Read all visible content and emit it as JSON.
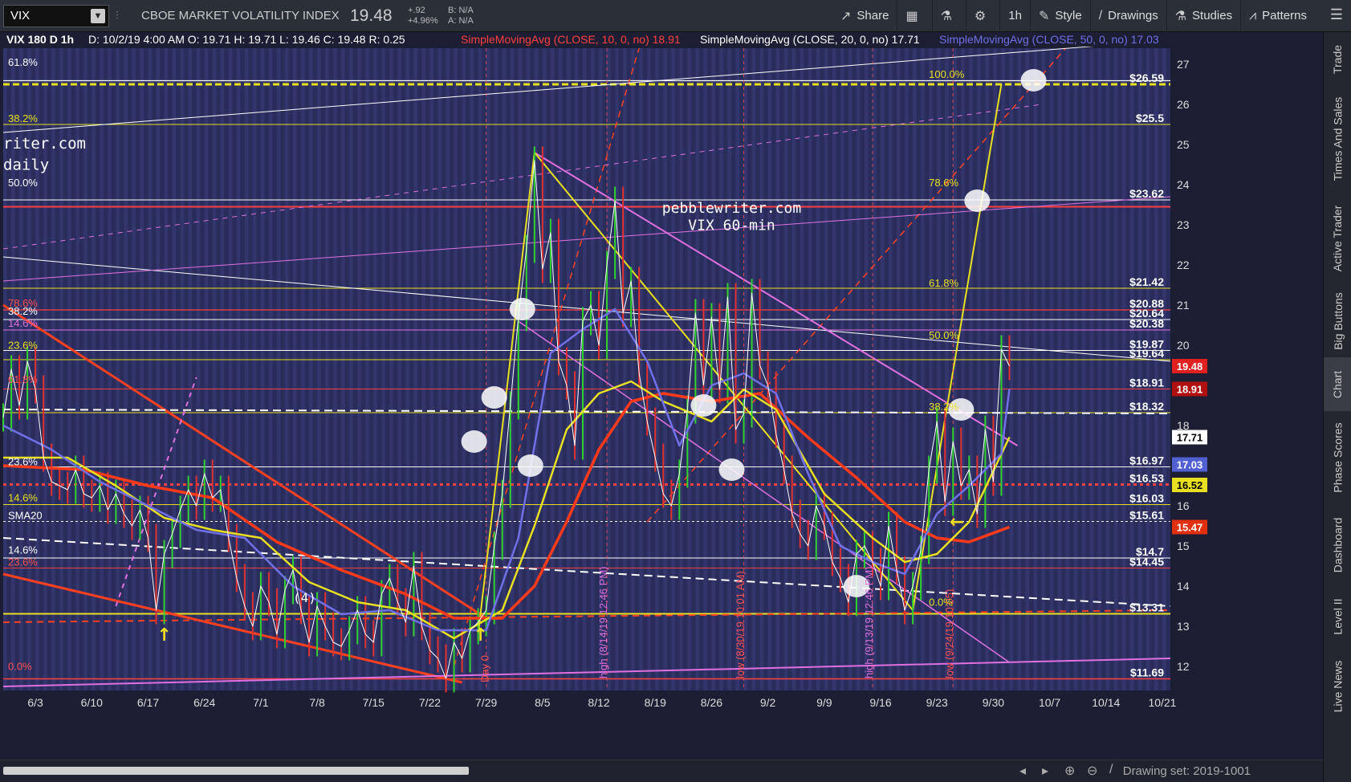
{
  "toolbar": {
    "symbol": "VIX",
    "description": "CBOE MARKET VOLATILITY INDEX",
    "last": "19.48",
    "change": "+.92",
    "change_pct": "+4.96%",
    "bid": "B: N/A",
    "ask": "A: N/A",
    "buttons": [
      {
        "label": "Share",
        "icon": "share-icon"
      },
      {
        "label": "",
        "icon": "grid-icon"
      },
      {
        "label": "",
        "icon": "flask-icon"
      },
      {
        "label": "",
        "icon": "gear-icon"
      },
      {
        "label": "1h",
        "icon": ""
      },
      {
        "label": "Style",
        "icon": "style-icon"
      },
      {
        "label": "Drawings",
        "icon": "pencil-icon"
      },
      {
        "label": "Studies",
        "icon": "flask-icon"
      },
      {
        "label": "Patterns",
        "icon": "patterns-icon"
      }
    ]
  },
  "sidebar": {
    "tabs": [
      "Trade",
      "Times And Sales",
      "Active Trader",
      "Big Buttons",
      "Chart",
      "Phase Scores",
      "Dashboard",
      "Level II",
      "Live News"
    ],
    "active": "Chart"
  },
  "header_info": {
    "title": "VIX 180 D 1h",
    "ohlc": "D: 10/2/19 4:00 AM  O: 19.71  H: 19.71  L: 19.46  C: 19.48  R: 0.25",
    "sma10": "SimpleMovingAvg (CLOSE, 10, 0, no)  18.91",
    "sma20": "SimpleMovingAvg (CLOSE, 20, 0, no)  17.71",
    "sma50": "SimpleMovingAvg (CLOSE, 50, 0, no)  17.03"
  },
  "status": {
    "drawing_set": "Drawing set: 2019-1001"
  },
  "watermark": {
    "line1": "pebblewriter.com",
    "line2": "VIX 60-min",
    "corner1": "riter.com",
    "corner2": "daily"
  },
  "annotations": [
    {
      "text": "(4)"
    },
    {
      "text": "high (8/14/19 12:46 PM)"
    },
    {
      "text": "low (8/30/19 10:01 AM)"
    },
    {
      "text": "high (9/13/19 12:46 PM)"
    },
    {
      "text": "low (9/24/19 10:05)"
    },
    {
      "text": "Day 0"
    }
  ],
  "chart_data": {
    "type": "line",
    "ylim": [
      11.4,
      27.4
    ],
    "y_ticks": [
      12,
      13,
      14,
      15,
      16,
      17,
      18,
      19,
      20,
      21,
      22,
      23,
      24,
      25,
      26,
      27
    ],
    "x_ticks": [
      "6/3",
      "6/10",
      "6/17",
      "6/24",
      "7/1",
      "7/8",
      "7/15",
      "7/22",
      "7/29",
      "8/5",
      "8/12",
      "8/19",
      "8/26",
      "9/2",
      "9/9",
      "9/16",
      "9/23",
      "9/30",
      "10/7",
      "10/14",
      "10/21"
    ],
    "x_tick_days": [
      0,
      7,
      14,
      21,
      28,
      35,
      42,
      49,
      56,
      63,
      70,
      77,
      84,
      91,
      98,
      105,
      112,
      119,
      126,
      133,
      140
    ],
    "x_range_days": [
      -4,
      141
    ],
    "price_series": [
      [
        -4,
        18.2
      ],
      [
        -3,
        19.4
      ],
      [
        -2,
        18.5
      ],
      [
        -1,
        19.6
      ],
      [
        0,
        18.9
      ],
      [
        1,
        17.2
      ],
      [
        2,
        16.6
      ],
      [
        3,
        16.5
      ],
      [
        4,
        16.4
      ],
      [
        5,
        16.9
      ],
      [
        6,
        16.3
      ],
      [
        7,
        16.2
      ],
      [
        8,
        16.5
      ],
      [
        9,
        15.9
      ],
      [
        10,
        16.3
      ],
      [
        11,
        15.8
      ],
      [
        12,
        15.5
      ],
      [
        13,
        15.9
      ],
      [
        14,
        15.2
      ],
      [
        15,
        13.4
      ],
      [
        16,
        14.8
      ],
      [
        17,
        15.3
      ],
      [
        18,
        15.9
      ],
      [
        19,
        16.4
      ],
      [
        20,
        16.0
      ],
      [
        21,
        16.8
      ],
      [
        22,
        16.2
      ],
      [
        23,
        16.4
      ],
      [
        24,
        15.2
      ],
      [
        25,
        14.2
      ],
      [
        26,
        13.5
      ],
      [
        27,
        13.0
      ],
      [
        28,
        14.0
      ],
      [
        29,
        13.6
      ],
      [
        30,
        12.8
      ],
      [
        31,
        13.9
      ],
      [
        32,
        14.4
      ],
      [
        33,
        13.4
      ],
      [
        34,
        12.6
      ],
      [
        35,
        13.5
      ],
      [
        36,
        13.0
      ],
      [
        37,
        12.6
      ],
      [
        38,
        12.5
      ],
      [
        39,
        12.9
      ],
      [
        40,
        13.4
      ],
      [
        41,
        12.8
      ],
      [
        42,
        12.6
      ],
      [
        43,
        13.8
      ],
      [
        44,
        14.2
      ],
      [
        45,
        13.6
      ],
      [
        46,
        13.1
      ],
      [
        47,
        14.5
      ],
      [
        48,
        13.0
      ],
      [
        49,
        12.4
      ],
      [
        50,
        12.2
      ],
      [
        51,
        11.7
      ],
      [
        52,
        12.6
      ],
      [
        53,
        12.2
      ],
      [
        54,
        12.9
      ],
      [
        55,
        13.1
      ],
      [
        56,
        13.4
      ],
      [
        57,
        15.0
      ],
      [
        58,
        16.3
      ],
      [
        59,
        18.5
      ],
      [
        60,
        20.7
      ],
      [
        61,
        22.4
      ],
      [
        62,
        24.6
      ],
      [
        63,
        21.9
      ],
      [
        64,
        22.8
      ],
      [
        65,
        19.6
      ],
      [
        66,
        19.0
      ],
      [
        67,
        17.5
      ],
      [
        68,
        20.6
      ],
      [
        69,
        21.0
      ],
      [
        70,
        20.0
      ],
      [
        71,
        22.0
      ],
      [
        72,
        23.6
      ],
      [
        73,
        20.8
      ],
      [
        74,
        21.6
      ],
      [
        75,
        19.3
      ],
      [
        76,
        18.1
      ],
      [
        77,
        17.2
      ],
      [
        78,
        16.3
      ],
      [
        79,
        16.0
      ],
      [
        80,
        16.8
      ],
      [
        81,
        18.4
      ],
      [
        82,
        20.8
      ],
      [
        83,
        19.0
      ],
      [
        84,
        20.7
      ],
      [
        85,
        18.9
      ],
      [
        86,
        21.2
      ],
      [
        87,
        17.9
      ],
      [
        88,
        18.3
      ],
      [
        89,
        21.3
      ],
      [
        90,
        19.5
      ],
      [
        91,
        19.0
      ],
      [
        92,
        17.8
      ],
      [
        93,
        16.9
      ],
      [
        94,
        15.8
      ],
      [
        95,
        15.3
      ],
      [
        96,
        15.0
      ],
      [
        97,
        16.0
      ],
      [
        98,
        15.5
      ],
      [
        99,
        14.6
      ],
      [
        100,
        14.2
      ],
      [
        101,
        13.6
      ],
      [
        102,
        14.8
      ],
      [
        103,
        15.0
      ],
      [
        104,
        14.6
      ],
      [
        105,
        14.0
      ],
      [
        106,
        15.5
      ],
      [
        107,
        14.4
      ],
      [
        108,
        13.4
      ],
      [
        109,
        14.0
      ],
      [
        110,
        14.9
      ],
      [
        111,
        16.9
      ],
      [
        112,
        18.1
      ],
      [
        113,
        16.1
      ],
      [
        114,
        17.6
      ],
      [
        115,
        16.5
      ],
      [
        116,
        16.9
      ],
      [
        117,
        15.8
      ],
      [
        118,
        17.9
      ],
      [
        119,
        16.6
      ],
      [
        120,
        19.9
      ],
      [
        121,
        19.48
      ]
    ],
    "sma10_series": [
      [
        -4,
        18.0
      ],
      [
        2,
        17.4
      ],
      [
        8,
        16.6
      ],
      [
        14,
        16.0
      ],
      [
        20,
        15.4
      ],
      [
        26,
        15.2
      ],
      [
        32,
        14.0
      ],
      [
        38,
        13.3
      ],
      [
        44,
        13.4
      ],
      [
        50,
        12.9
      ],
      [
        56,
        12.9
      ],
      [
        60,
        15.2
      ],
      [
        64,
        19.8
      ],
      [
        68,
        20.4
      ],
      [
        72,
        20.9
      ],
      [
        76,
        19.6
      ],
      [
        80,
        17.5
      ],
      [
        84,
        19.0
      ],
      [
        88,
        19.3
      ],
      [
        92,
        18.8
      ],
      [
        96,
        16.8
      ],
      [
        100,
        15.0
      ],
      [
        104,
        14.6
      ],
      [
        108,
        14.3
      ],
      [
        112,
        15.8
      ],
      [
        116,
        16.5
      ],
      [
        120,
        17.3
      ],
      [
        121,
        18.91
      ]
    ],
    "sma20_series": [
      [
        -4,
        17.2
      ],
      [
        4,
        17.2
      ],
      [
        10,
        16.5
      ],
      [
        16,
        15.7
      ],
      [
        22,
        15.4
      ],
      [
        28,
        15.2
      ],
      [
        34,
        14.1
      ],
      [
        40,
        13.6
      ],
      [
        46,
        13.4
      ],
      [
        52,
        12.7
      ],
      [
        58,
        13.4
      ],
      [
        62,
        15.5
      ],
      [
        66,
        17.9
      ],
      [
        70,
        18.8
      ],
      [
        74,
        19.1
      ],
      [
        78,
        18.6
      ],
      [
        84,
        18.1
      ],
      [
        88,
        18.9
      ],
      [
        92,
        18.4
      ],
      [
        98,
        16.3
      ],
      [
        104,
        15.2
      ],
      [
        108,
        14.6
      ],
      [
        112,
        14.8
      ],
      [
        116,
        15.6
      ],
      [
        121,
        17.71
      ]
    ],
    "sma50_series": [
      [
        -4,
        17.0
      ],
      [
        6,
        16.9
      ],
      [
        14,
        16.5
      ],
      [
        22,
        16.2
      ],
      [
        30,
        15.1
      ],
      [
        38,
        14.4
      ],
      [
        46,
        13.8
      ],
      [
        52,
        13.2
      ],
      [
        58,
        13.2
      ],
      [
        62,
        14.0
      ],
      [
        66,
        15.6
      ],
      [
        70,
        17.4
      ],
      [
        74,
        18.6
      ],
      [
        78,
        18.8
      ],
      [
        84,
        18.6
      ],
      [
        90,
        18.8
      ],
      [
        96,
        17.7
      ],
      [
        102,
        16.7
      ],
      [
        108,
        15.6
      ],
      [
        112,
        15.2
      ],
      [
        116,
        15.1
      ],
      [
        121,
        15.47
      ]
    ],
    "right_axis_labels": [
      {
        "value": 26.5,
        "text": "$26.59"
      },
      {
        "value": 25.5,
        "text": "$25.5"
      },
      {
        "value": 23.62,
        "text": "$23.62"
      },
      {
        "value": 21.42,
        "text": "$21.42"
      },
      {
        "value": 20.88,
        "text": "$20.88"
      },
      {
        "value": 20.64,
        "text": "$20.64"
      },
      {
        "value": 20.38,
        "text": "$20.38"
      },
      {
        "value": 19.87,
        "text": "$19.87"
      },
      {
        "value": 19.64,
        "text": "$19.64"
      },
      {
        "value": 18.91,
        "text": "$18.91"
      },
      {
        "value": 18.32,
        "text": "$18.32"
      },
      {
        "value": 16.97,
        "text": "$16.97"
      },
      {
        "value": 16.53,
        "text": "$16.53"
      },
      {
        "value": 16.03,
        "text": "$16.03"
      },
      {
        "value": 15.61,
        "text": "$15.61"
      },
      {
        "value": 14.7,
        "text": "$14.7"
      },
      {
        "value": 14.45,
        "text": "$14.45"
      },
      {
        "value": 13.31,
        "text": "$13.31"
      },
      {
        "value": 11.69,
        "text": "$11.69"
      }
    ],
    "price_tags": [
      {
        "value": 19.48,
        "text": "19.48",
        "color": "#e02020",
        "fg": "#fff"
      },
      {
        "value": 18.91,
        "text": "18.91",
        "color": "#b01010",
        "fg": "#fff"
      },
      {
        "value": 17.71,
        "text": "17.71",
        "color": "#ffffff",
        "fg": "#000"
      },
      {
        "value": 17.03,
        "text": "17.03",
        "color": "#5060d0",
        "fg": "#fff"
      },
      {
        "value": 16.52,
        "text": "16.52",
        "color": "#e8e020",
        "fg": "#000"
      },
      {
        "value": 15.47,
        "text": "15.47",
        "color": "#e03010",
        "fg": "#fff"
      }
    ],
    "left_fib_labels": [
      {
        "value": 26.9,
        "text": "61.8%",
        "color": "#ffffff"
      },
      {
        "value": 25.5,
        "text": "38.2%",
        "color": "#e8e020"
      },
      {
        "value": 23.9,
        "text": "50.0%",
        "color": "#ffffff"
      },
      {
        "value": 20.9,
        "text": "78.6%",
        "color": "#ff5050"
      },
      {
        "value": 20.7,
        "text": "38.2%",
        "color": "#ffffff"
      },
      {
        "value": 20.4,
        "text": "14.6%",
        "color": "#e070e0"
      },
      {
        "value": 19.85,
        "text": "23.6%",
        "color": "#e8e020"
      },
      {
        "value": 19.0,
        "text": "61.8%",
        "color": "#ff5050"
      },
      {
        "value": 16.95,
        "text": "23.6%",
        "color": "#ffffff"
      },
      {
        "value": 16.05,
        "text": "14.6%",
        "color": "#e8e020"
      },
      {
        "value": 15.61,
        "text": "SMA20",
        "color": "#ffffff"
      },
      {
        "value": 14.75,
        "text": "14.6%",
        "color": "#ffffff"
      },
      {
        "value": 14.45,
        "text": "23.6%",
        "color": "#ff5050"
      },
      {
        "value": 11.85,
        "text": "0.0%",
        "color": "#ff5050"
      }
    ],
    "inner_fib_labels": [
      {
        "value": 26.6,
        "text": "100.0%"
      },
      {
        "value": 23.9,
        "text": "78.6%"
      },
      {
        "value": 21.4,
        "text": "61.8%"
      },
      {
        "value": 20.1,
        "text": "50.0%"
      },
      {
        "value": 18.32,
        "text": "38.2%"
      },
      {
        "value": 13.45,
        "text": "0.0%"
      }
    ]
  }
}
